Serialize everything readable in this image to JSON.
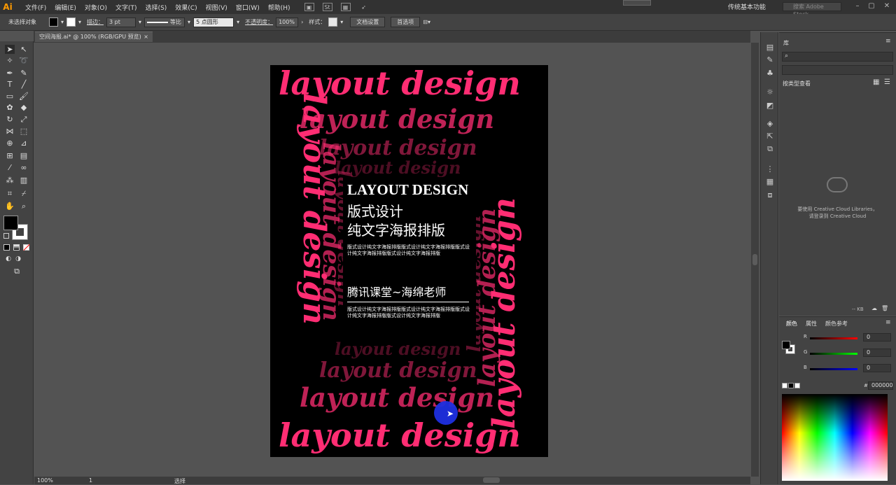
{
  "menubar": {
    "logo": "Ai",
    "items": [
      "文件(F)",
      "编辑(E)",
      "对象(O)",
      "文字(T)",
      "选择(S)",
      "效果(C)",
      "视图(V)",
      "窗口(W)",
      "帮助(H)"
    ],
    "workspace": "传统基本功能",
    "search_placeholder": "搜索 Adobe Stock"
  },
  "controlbar": {
    "selection": "未选择对象",
    "stroke_label": "描边：",
    "stroke_value": "3 pt",
    "stroke_style": "等比",
    "brush": "5 点圆形",
    "opacity_label": "不透明度：",
    "opacity_value": "100%",
    "style_label": "样式：",
    "doc_setup": "文档设置",
    "prefs": "首选项"
  },
  "document": {
    "tab_title": "空间海报.ai* @ 100% (RGB/GPU 预览)",
    "close": "×"
  },
  "poster": {
    "word": "layout design",
    "title": "LAYOUT DESIGN",
    "subtitle1": "版式设计",
    "subtitle2": "纯文字海报排版",
    "body1": "版式设计纯文字海报排版版式设计纯文字海报排版版式设计纯文字海报排版版式设计纯文字海报排版",
    "author": "腾讯课堂~海绵老师",
    "body2": "版式设计纯文字海报排版版式设计纯文字海报排版版式设计纯文字海报排版版式设计纯文字海报排版"
  },
  "statusbar": {
    "zoom": "100%",
    "artboard": "1",
    "tool": "选择"
  },
  "library": {
    "tab": "库",
    "view_label": "按类型查看",
    "message_line1": "要使用 Creative Cloud Libraries，",
    "message_line2": "请登录到 Creative Cloud",
    "size": "-- KB"
  },
  "color": {
    "tabs": [
      "颜色",
      "属性",
      "颜色参考"
    ],
    "r_label": "R",
    "g_label": "G",
    "b_label": "B",
    "r": "0",
    "g": "0",
    "b": "0",
    "hex_label": "#",
    "hex": "000000"
  },
  "colors": {
    "accent_pink": "#ff2d73",
    "cursor_blue": "#1d2fe0"
  }
}
